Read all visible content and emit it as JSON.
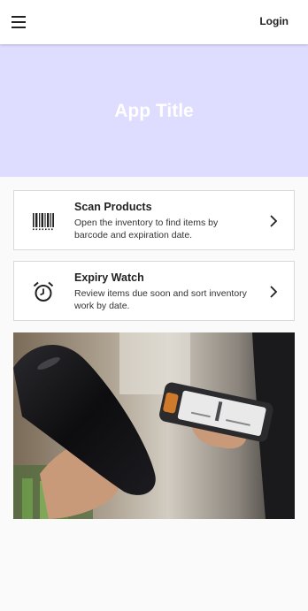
{
  "header": {
    "menu_icon": "hamburger-menu-icon",
    "login_label": "Login"
  },
  "hero": {
    "title": "App Title",
    "background_color": "#dedcff"
  },
  "cards": [
    {
      "icon": "barcode-icon",
      "title": "Scan Products",
      "description": "Open the inventory to find items by barcode and expiration date."
    },
    {
      "icon": "alarm-clock-icon",
      "title": "Expiry Watch",
      "description": "Review items due soon and sort inventory work by date."
    }
  ],
  "image": {
    "subject": "photo"
  }
}
